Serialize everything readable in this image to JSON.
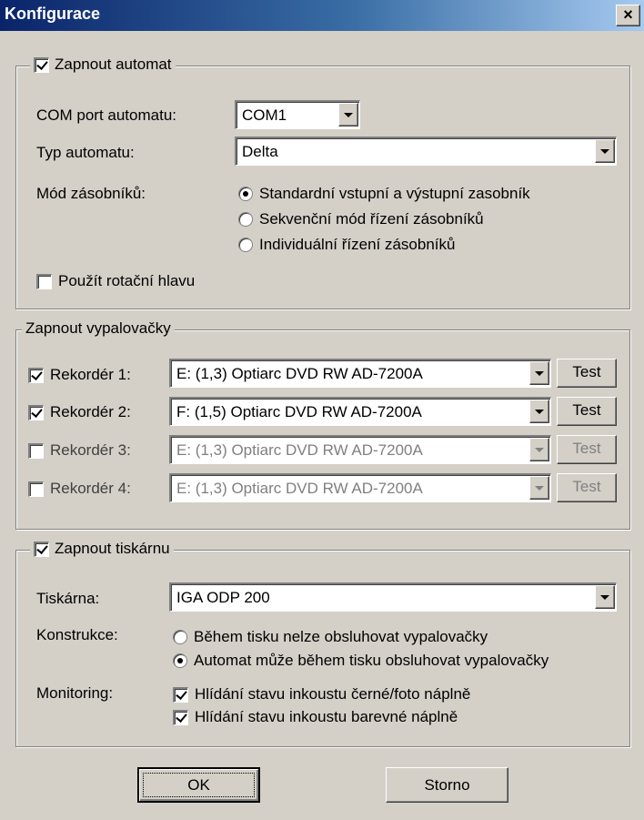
{
  "window": {
    "title": "Konfigurace",
    "close_label": "×"
  },
  "automat": {
    "enable_label": "Zapnout automat",
    "enabled": true,
    "com_port_label": "COM port automatu:",
    "com_port_value": "COM1",
    "type_label": "Typ automatu:",
    "type_value": "Delta",
    "mode_label": "Mód zásobníků:",
    "modes": [
      {
        "label": "Standardní vstupní a výstupní zasobník",
        "selected": true
      },
      {
        "label": "Sekvenční mód řízení zásobníků",
        "selected": false
      },
      {
        "label": "Individuální řízení zásobníků",
        "selected": false
      }
    ],
    "rotary_head_label": "Použít rotační hlavu",
    "rotary_head_checked": false
  },
  "burners": {
    "group_label": "Zapnout vypalovačky",
    "test_label": "Test",
    "recorders": [
      {
        "label": "Rekordér 1:",
        "checked": true,
        "drive": "E:  (1,3)  Optiarc  DVD RW AD-7200A",
        "enabled": true
      },
      {
        "label": "Rekordér 2:",
        "checked": true,
        "drive": "F:  (1,5)  Optiarc  DVD RW AD-7200A",
        "enabled": true
      },
      {
        "label": "Rekordér 3:",
        "checked": false,
        "drive": "E:  (1,3)  Optiarc  DVD RW AD-7200A",
        "enabled": false
      },
      {
        "label": "Rekordér 4:",
        "checked": false,
        "drive": "E:  (1,3)  Optiarc  DVD RW AD-7200A",
        "enabled": false
      }
    ]
  },
  "printer": {
    "enable_label": "Zapnout tiskárnu",
    "enabled": true,
    "printer_label": "Tiskárna:",
    "printer_value": "IGA ODP 200",
    "construction_label": "Konstrukce:",
    "construction_options": [
      {
        "label": "Během tisku nelze obsluhovat vypalovačky",
        "selected": false
      },
      {
        "label": "Automat může během tisku obsluhovat vypalovačky",
        "selected": true
      }
    ],
    "monitoring_label": "Monitoring:",
    "monitoring_options": [
      {
        "label": "Hlídání stavu inkoustu černé/foto náplně",
        "checked": true
      },
      {
        "label": "Hlídání stavu inkoustu barevné náplně",
        "checked": true
      }
    ]
  },
  "buttons": {
    "ok_label": "OK",
    "cancel_label": "Storno"
  }
}
